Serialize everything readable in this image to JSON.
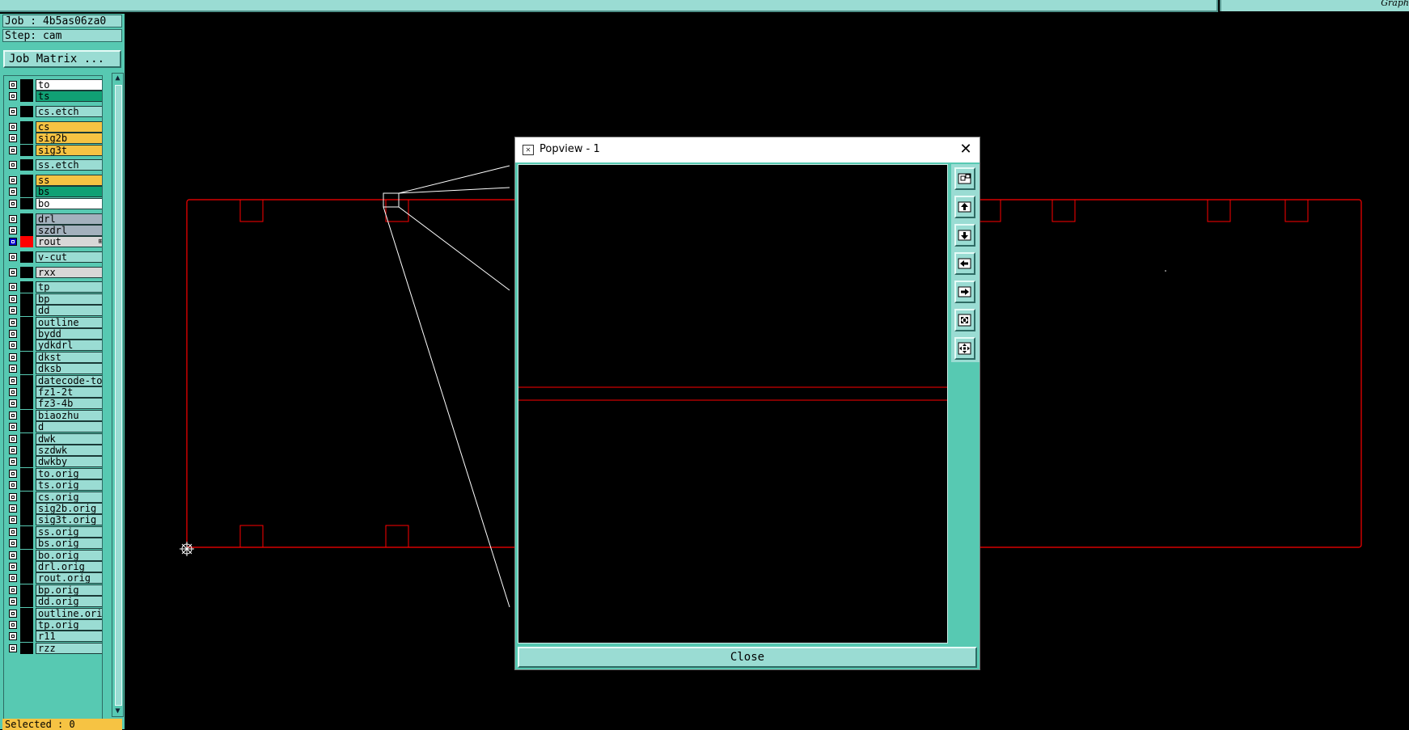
{
  "topbar": {
    "right_label": "Graph"
  },
  "job": {
    "label": "Job : 4b5as06za0"
  },
  "step": {
    "label": "Step: cam"
  },
  "job_matrix_button": "Job Matrix ...",
  "layers": [
    {
      "name": "to",
      "color": "#ffffff"
    },
    {
      "name": "ts",
      "color": "#10a074"
    },
    {
      "name": "cs.etch",
      "color": "#9adcd3"
    },
    {
      "name": "cs",
      "color": "#f6c343"
    },
    {
      "name": "sig2b",
      "color": "#f6c343"
    },
    {
      "name": "sig3t",
      "color": "#f6c343"
    },
    {
      "name": "ss.etch",
      "color": "#9adcd3"
    },
    {
      "name": "ss",
      "color": "#f6c343"
    },
    {
      "name": "bs",
      "color": "#10a074"
    },
    {
      "name": "bo",
      "color": "#ffffff"
    },
    {
      "name": "drl",
      "color": "#a3b1bd"
    },
    {
      "name": "szdrl",
      "color": "#a3b1bd"
    },
    {
      "name": "rout",
      "color": "#d7d7d7",
      "active": true,
      "marker": "⊞"
    },
    {
      "name": "v-cut",
      "color": "#9adcd3"
    },
    {
      "name": "rxx",
      "color": "#d7d7d7"
    },
    {
      "name": "tp",
      "color": "#9adcd3"
    },
    {
      "name": "bp",
      "color": "#9adcd3"
    },
    {
      "name": "dd",
      "color": "#9adcd3"
    },
    {
      "name": "outline",
      "color": "#9adcd3"
    },
    {
      "name": "bydd",
      "color": "#9adcd3"
    },
    {
      "name": "ydkdrl",
      "color": "#9adcd3"
    },
    {
      "name": "dkst",
      "color": "#9adcd3"
    },
    {
      "name": "dksb",
      "color": "#9adcd3"
    },
    {
      "name": "datecode-to",
      "color": "#9adcd3"
    },
    {
      "name": "fz1-2t",
      "color": "#9adcd3"
    },
    {
      "name": "fz3-4b",
      "color": "#9adcd3"
    },
    {
      "name": "biaozhu",
      "color": "#9adcd3"
    },
    {
      "name": "d",
      "color": "#9adcd3"
    },
    {
      "name": "dwk",
      "color": "#9adcd3"
    },
    {
      "name": "szdwk",
      "color": "#9adcd3"
    },
    {
      "name": "dwkby",
      "color": "#9adcd3"
    },
    {
      "name": "to.orig",
      "color": "#9adcd3"
    },
    {
      "name": "ts.orig",
      "color": "#9adcd3"
    },
    {
      "name": "cs.orig",
      "color": "#9adcd3"
    },
    {
      "name": "sig2b.orig",
      "color": "#9adcd3"
    },
    {
      "name": "sig3t.orig",
      "color": "#9adcd3"
    },
    {
      "name": "ss.orig",
      "color": "#9adcd3"
    },
    {
      "name": "bs.orig",
      "color": "#9adcd3"
    },
    {
      "name": "bo.orig",
      "color": "#9adcd3"
    },
    {
      "name": "drl.orig",
      "color": "#9adcd3"
    },
    {
      "name": "rout.orig",
      "color": "#9adcd3"
    },
    {
      "name": "bp.orig",
      "color": "#9adcd3"
    },
    {
      "name": "dd.orig",
      "color": "#9adcd3"
    },
    {
      "name": "outline.orig",
      "color": "#9adcd3"
    },
    {
      "name": "tp.orig",
      "color": "#9adcd3"
    },
    {
      "name": "r11",
      "color": "#9adcd3"
    },
    {
      "name": "rzz",
      "color": "#9adcd3"
    }
  ],
  "selected": {
    "label": "Selected : 0"
  },
  "popview": {
    "title": "Popview - 1",
    "close_button": "Close",
    "tools": [
      "zoom-window-icon",
      "pan-up-icon",
      "pan-down-icon",
      "pan-left-icon",
      "pan-right-icon",
      "zoom-out-icon",
      "zoom-fit-icon"
    ]
  },
  "colors": {
    "panel": "#57c9b2",
    "panel_light": "#9adcd3",
    "board_outline": "#ff0000",
    "highlight": "#f6c343"
  }
}
